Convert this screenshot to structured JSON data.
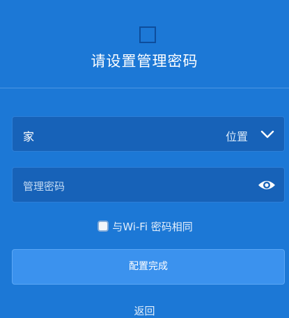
{
  "header": {
    "logo": "square-outline-icon",
    "title": "请设置管理密码"
  },
  "form": {
    "location_field": {
      "value": "家",
      "label": "位置",
      "dropdown_icon": "chevron-down-icon"
    },
    "password_field": {
      "placeholder": "管理密码",
      "visibility_icon": "eye-icon"
    },
    "same_as_wifi": {
      "checked": false,
      "label": "与Wi-Fi 密码相同"
    },
    "confirm_button_label": "配置完成",
    "back_label": "返回"
  },
  "colors": {
    "background": "#1c78d6",
    "field_background": "#1762b8",
    "button_background": "#3b92ee",
    "text": "#ffffff"
  }
}
